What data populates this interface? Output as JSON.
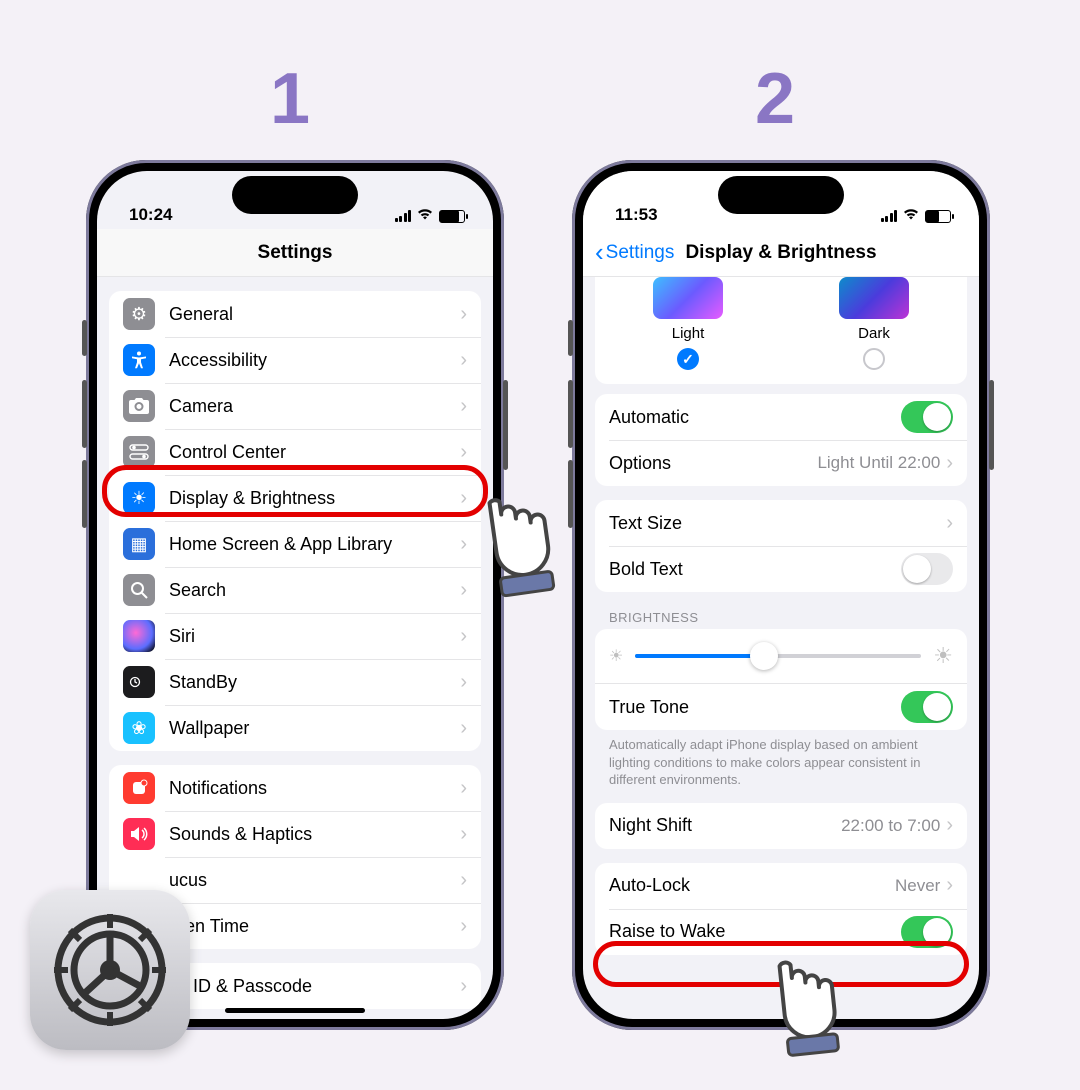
{
  "steps": {
    "one": "1",
    "two": "2"
  },
  "phone1": {
    "time": "10:24",
    "title": "Settings",
    "items_a": [
      {
        "label": "General",
        "icon": "gear",
        "bg": "bg-gray"
      },
      {
        "label": "Accessibility",
        "icon": "person",
        "bg": "bg-blue"
      },
      {
        "label": "Camera",
        "icon": "camera",
        "bg": "bg-gray"
      },
      {
        "label": "Control Center",
        "icon": "switches",
        "bg": "bg-gray"
      },
      {
        "label": "Display & Brightness",
        "icon": "sun",
        "bg": "bg-blue"
      },
      {
        "label": "Home Screen & App Library",
        "icon": "grid",
        "bg": "bg-blue"
      },
      {
        "label": "Search",
        "icon": "search",
        "bg": "bg-gray"
      },
      {
        "label": "Siri",
        "icon": "siri",
        "bg": "bg-black"
      },
      {
        "label": "StandBy",
        "icon": "clock",
        "bg": "bg-black"
      },
      {
        "label": "Wallpaper",
        "icon": "flower",
        "bg": "bg-blue"
      }
    ],
    "items_b": [
      {
        "label": "Notifications",
        "icon": "bell",
        "bg": "bg-red"
      },
      {
        "label": "Sounds & Haptics",
        "icon": "speaker",
        "bg": "bg-red"
      },
      {
        "label": "Focus",
        "icon": "moon",
        "bg": "bg-purple",
        "cut": "ucus"
      },
      {
        "label": "Screen Time",
        "icon": "hourglass",
        "bg": "bg-purple",
        "cut": "reen Time"
      },
      {
        "label": "Face ID & Passcode",
        "icon": "",
        "bg": "",
        "cut": "ce ID & Passcode"
      }
    ]
  },
  "phone2": {
    "time": "11:53",
    "back": "Settings",
    "title": "Display & Brightness",
    "appearance": {
      "light": "Light",
      "dark": "Dark"
    },
    "automatic": {
      "label": "Automatic",
      "on": true
    },
    "options": {
      "label": "Options",
      "value": "Light Until 22:00"
    },
    "textsize": {
      "label": "Text Size"
    },
    "boldtext": {
      "label": "Bold Text",
      "on": false
    },
    "brightness_hdr": "Brightness",
    "truetone": {
      "label": "True Tone",
      "on": true
    },
    "truetone_footer": "Automatically adapt iPhone display based on ambient lighting conditions to make colors appear consistent in different environments.",
    "nightshift": {
      "label": "Night Shift",
      "value": "22:00 to 7:00"
    },
    "autolock": {
      "label": "Auto-Lock",
      "value": "Never"
    },
    "raise": {
      "label": "Raise to Wake",
      "on": true
    }
  }
}
